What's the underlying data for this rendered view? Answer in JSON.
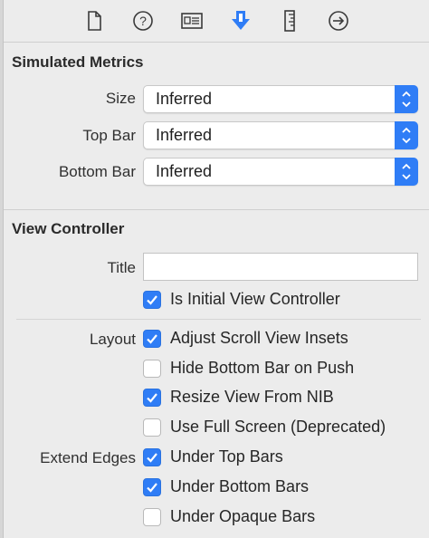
{
  "toolbar": {
    "icons": [
      "file-inspector-icon",
      "help-icon",
      "identity-inspector-icon",
      "attributes-inspector-icon",
      "size-inspector-icon",
      "connections-inspector-icon"
    ],
    "accent": "#2f7df6"
  },
  "simulated_metrics": {
    "title": "Simulated Metrics",
    "size_label": "Size",
    "size_value": "Inferred",
    "top_bar_label": "Top Bar",
    "top_bar_value": "Inferred",
    "bottom_bar_label": "Bottom Bar",
    "bottom_bar_value": "Inferred"
  },
  "view_controller": {
    "title": "View Controller",
    "title_field_label": "Title",
    "title_field_value": "",
    "is_initial": {
      "label": "Is Initial View Controller",
      "checked": true
    },
    "layout_label": "Layout",
    "layout_options": [
      {
        "label": "Adjust Scroll View Insets",
        "checked": true
      },
      {
        "label": "Hide Bottom Bar on Push",
        "checked": false
      },
      {
        "label": "Resize View From NIB",
        "checked": true
      },
      {
        "label": "Use Full Screen (Deprecated)",
        "checked": false
      }
    ],
    "extend_edges_label": "Extend Edges",
    "extend_edges_options": [
      {
        "label": "Under Top Bars",
        "checked": true
      },
      {
        "label": "Under Bottom Bars",
        "checked": true
      },
      {
        "label": "Under Opaque Bars",
        "checked": false
      }
    ]
  }
}
